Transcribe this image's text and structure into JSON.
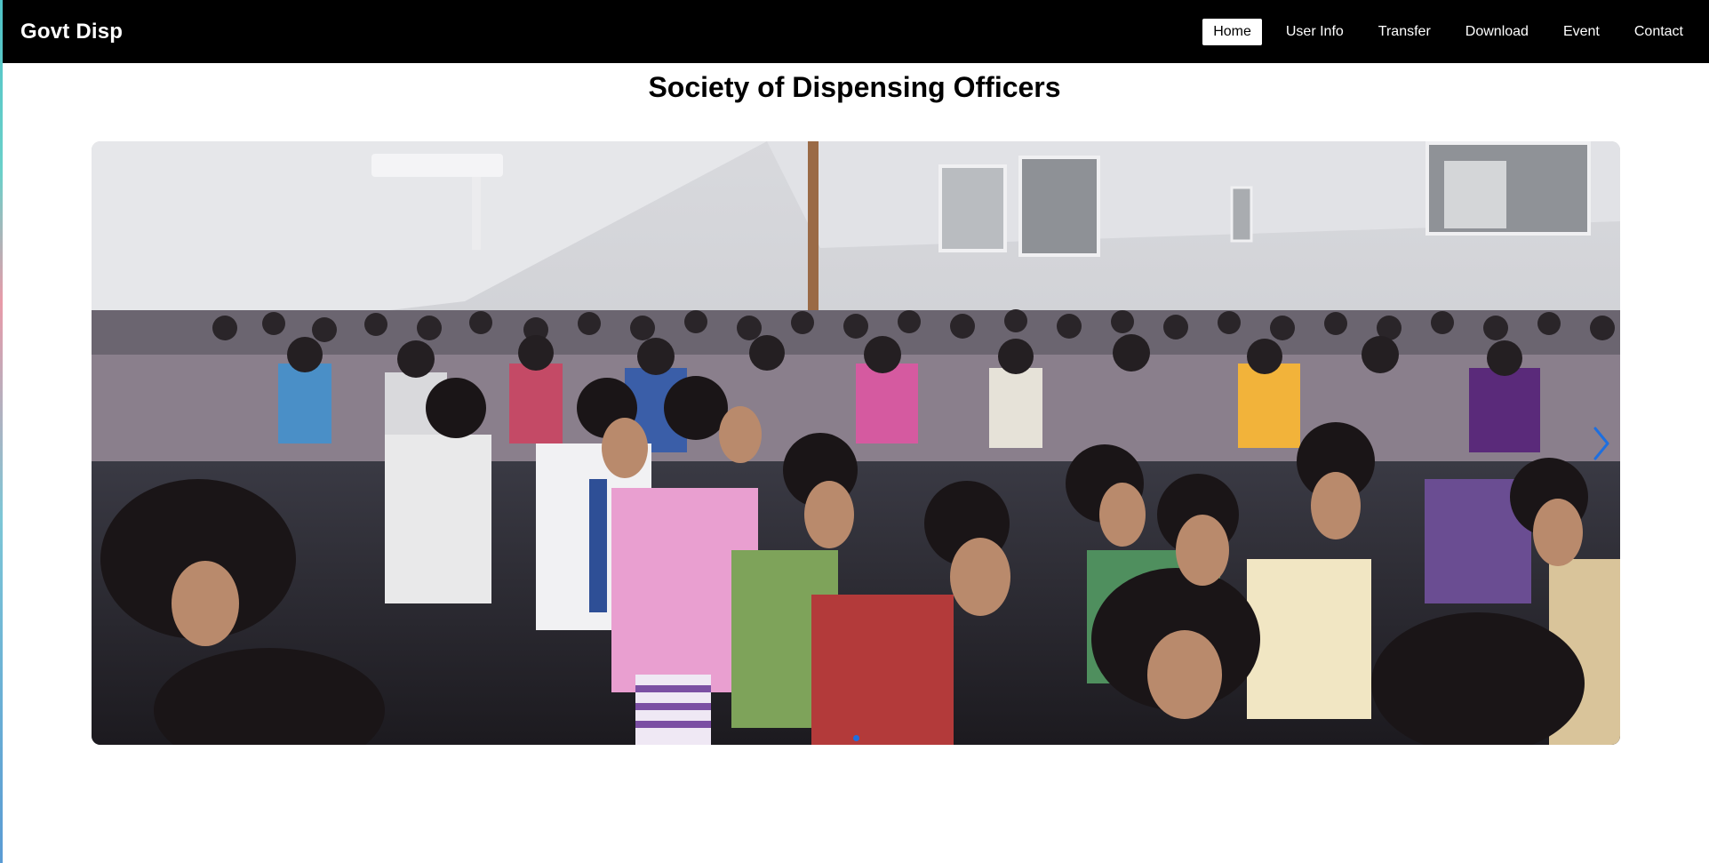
{
  "navbar": {
    "brand": "Govt Disp",
    "links": [
      {
        "label": "Home",
        "active": true
      },
      {
        "label": "User Info",
        "active": false
      },
      {
        "label": "Transfer",
        "active": false
      },
      {
        "label": "Download",
        "active": false
      },
      {
        "label": "Event",
        "active": false
      },
      {
        "label": "Contact",
        "active": false
      }
    ]
  },
  "main": {
    "title": "Society of Dispensing Officers"
  },
  "carousel": {
    "next_icon": "chevron-right-icon",
    "slide_count": 1,
    "active_slide": 1
  },
  "colors": {
    "navbar_bg": "#000000",
    "accent": "#1d6fe0"
  }
}
